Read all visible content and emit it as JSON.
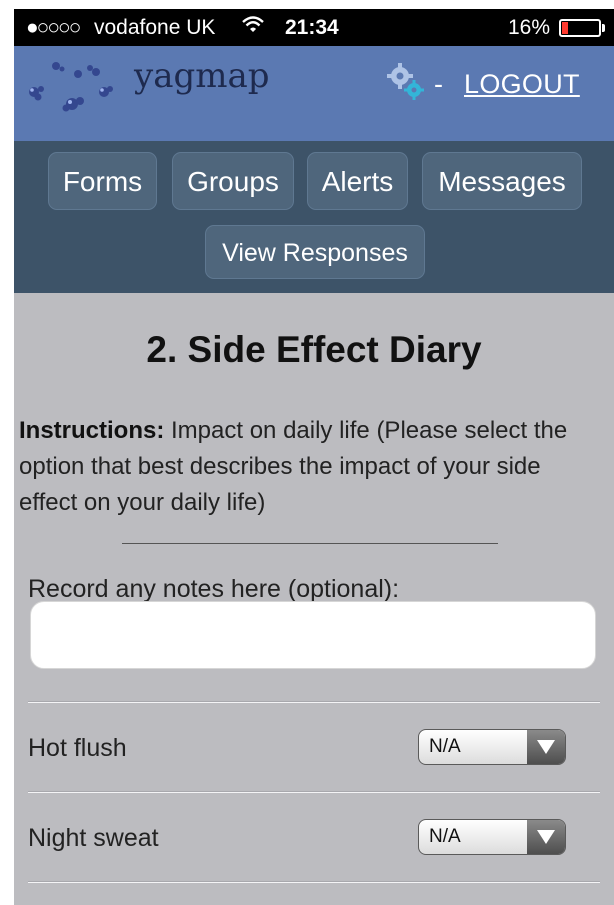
{
  "status_bar": {
    "signal": "●○○○○",
    "carrier": "vodafone UK",
    "wifi_icon": "wifi-icon",
    "time": "21:34",
    "battery_percent": "16%",
    "battery_level": 0.16,
    "battery_color": "#ff3b30"
  },
  "header": {
    "logo": "yagmap",
    "separator": "-",
    "logout_label": "LOGOUT",
    "background": "#5b79b2"
  },
  "nav": {
    "background": "#3d5368",
    "items": [
      {
        "label": "Forms"
      },
      {
        "label": "Groups"
      },
      {
        "label": "Alerts"
      },
      {
        "label": "Messages"
      },
      {
        "label": "View Responses"
      }
    ]
  },
  "form": {
    "title": "2. Side Effect Diary",
    "instructions_label": "Instructions:",
    "instructions_text": " Impact on daily life (Please select the option that best describes the impact of your side effect on your daily life)",
    "notes_label": "Record any notes here (optional):",
    "notes_value": "",
    "rows": [
      {
        "label": "Hot flush",
        "selected": "N/A"
      },
      {
        "label": "Night sweat",
        "selected": "N/A"
      }
    ]
  }
}
